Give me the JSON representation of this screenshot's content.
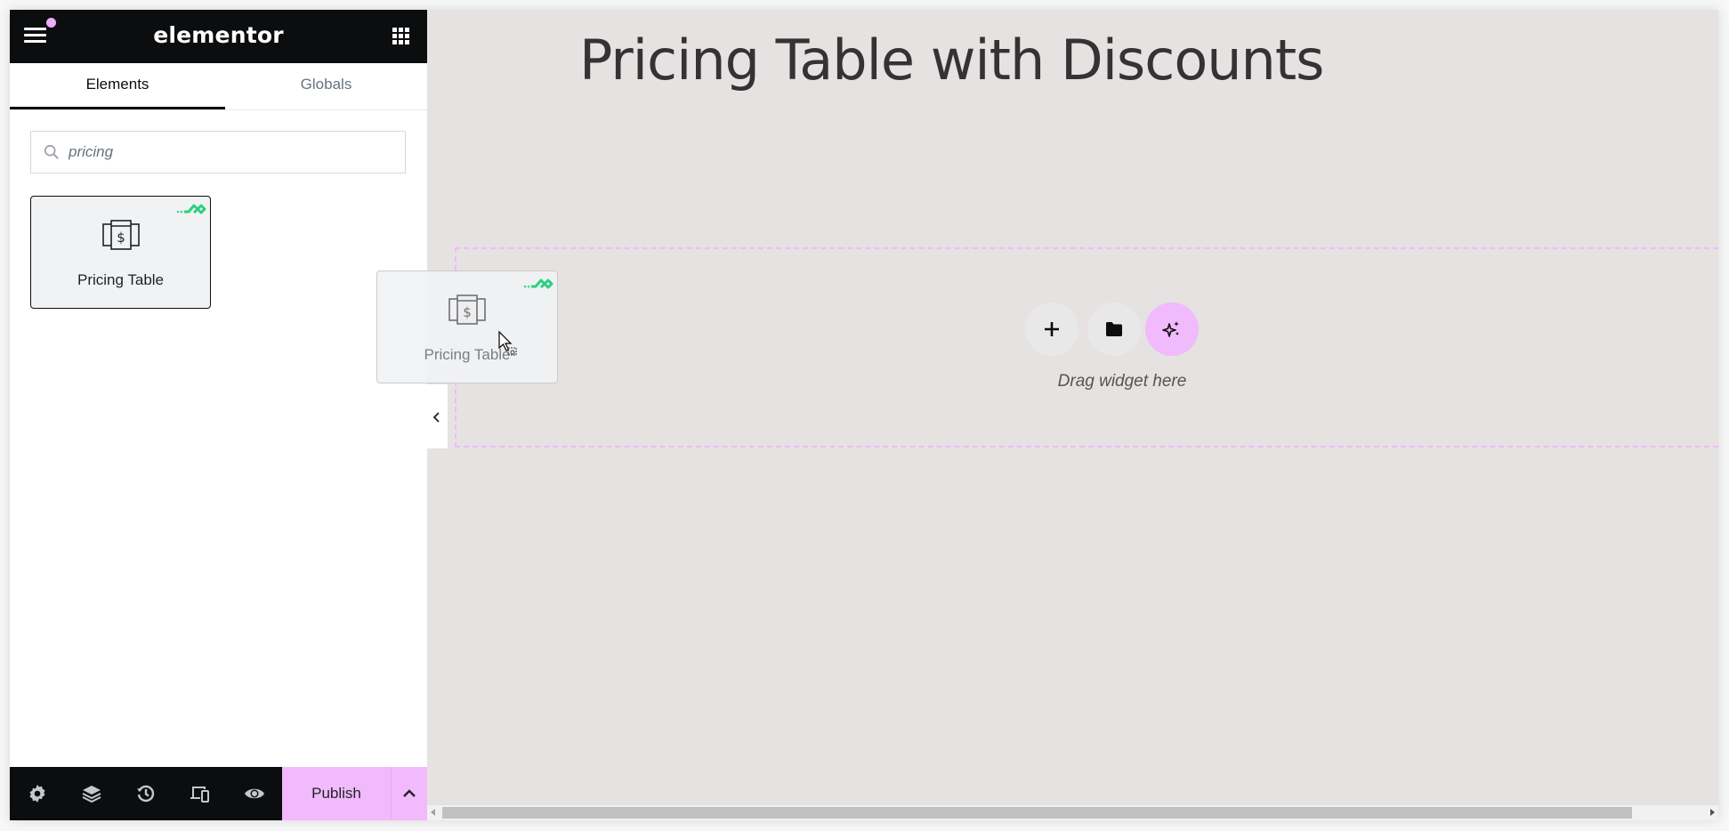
{
  "header": {
    "logo": "elementor",
    "menu_icon": "hamburger-menu-icon",
    "apps_icon": "grid-apps-icon",
    "notification_color": "#f0abfc"
  },
  "tabs": [
    {
      "label": "Elements",
      "active": true
    },
    {
      "label": "Globals",
      "active": false
    }
  ],
  "search": {
    "value": "pricing",
    "icon": "search-icon"
  },
  "widgets": [
    {
      "label": "Pricing Table",
      "icon": "pricing-table-icon",
      "pro": true
    }
  ],
  "footer": {
    "icons": [
      "settings-icon",
      "navigator-layers-icon",
      "history-icon",
      "responsive-mode-icon",
      "preview-eye-icon"
    ],
    "publish_label": "Publish",
    "publish_color": "#f0bafc"
  },
  "canvas": {
    "page_title": "Pricing Table with Discounts",
    "drop_text": "Drag widget here",
    "buttons": [
      "add-section",
      "template-library",
      "ai-generate"
    ],
    "accent": "#f0bafc"
  },
  "drag_ghost": {
    "label": "Pricing Table"
  }
}
